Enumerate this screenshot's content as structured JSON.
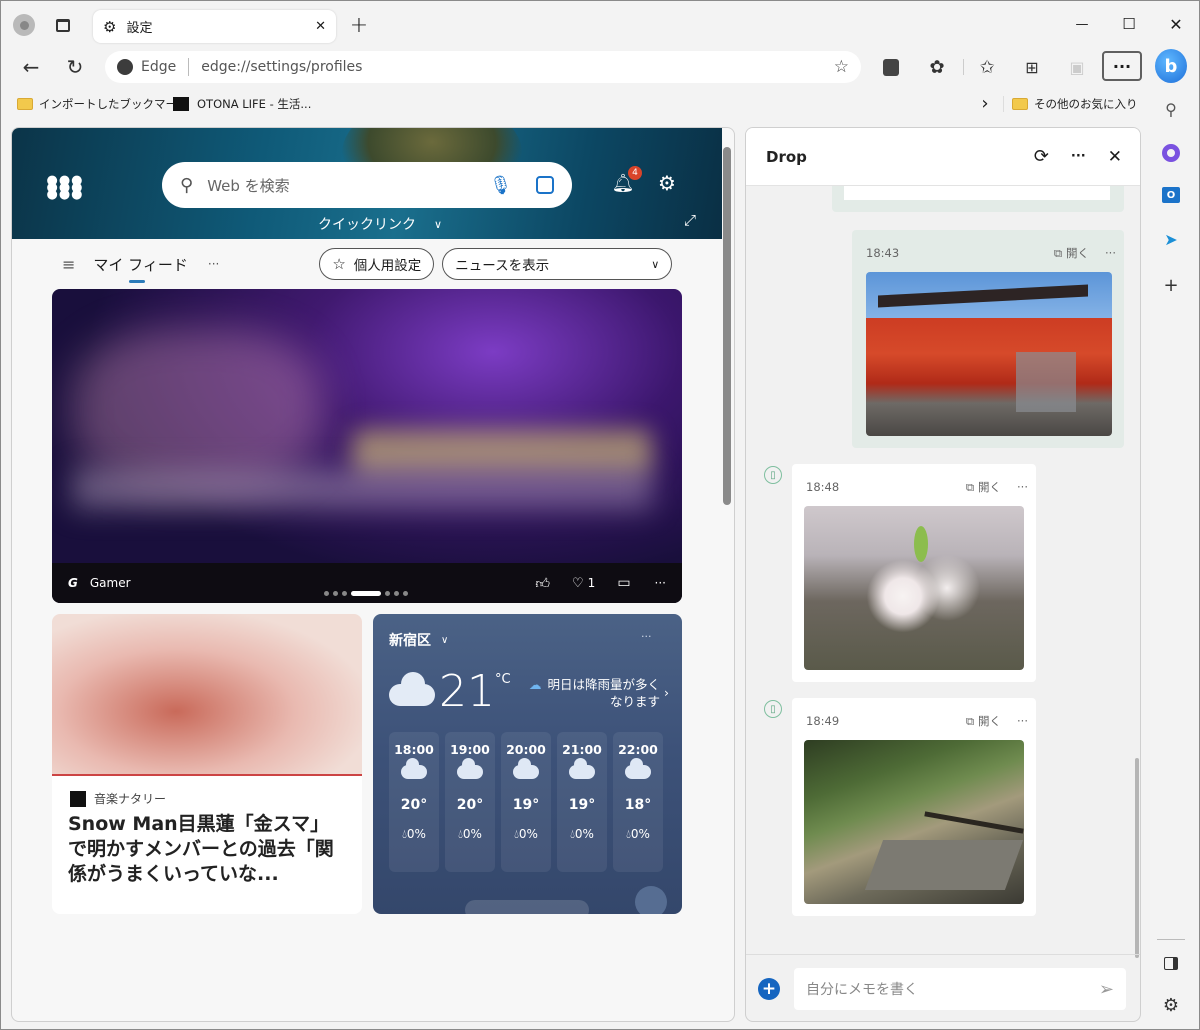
{
  "window": {
    "tab_title": "設定",
    "new_tab_glyph": "+",
    "controls": {
      "minimize": "—",
      "maximize": "☐",
      "close": "✕"
    }
  },
  "toolbar": {
    "back_glyph": "←",
    "refresh_glyph": "↻",
    "address_site": "Edge",
    "address_url": "edge://settings/profiles",
    "more_glyph": "···"
  },
  "bookmarks": {
    "items": [
      {
        "label": "インポートしたブックマー...",
        "icon": "folder-icon"
      },
      {
        "label": "OTONA LIFE - 生活...",
        "icon": "otona-favicon"
      }
    ],
    "overflow_glyph": "›",
    "other_label": "その他のお気に入り"
  },
  "newtab": {
    "search_placeholder": "Web を検索",
    "notification_count": "4",
    "quick_links_label": "クイックリンク",
    "feed_label": "マイ フィード",
    "feed_more": "···",
    "personalize_label": "個人用設定",
    "news_dropdown": "ニュースを表示",
    "hero": {
      "source": "Gamer",
      "dislike_count": "1",
      "more": "···",
      "carousel_total": 7,
      "carousel_active": 4
    },
    "news": {
      "source": "音楽ナタリー",
      "headline": "Snow Man目黒蓮「金スマ」で明かすメンバーとの過去「関係がうまくいっていな..."
    },
    "weather": {
      "location": "新宿区",
      "more": "···",
      "temp": "21",
      "unit": "°C",
      "alert": "明日は降雨量が多くなります",
      "hours": [
        {
          "time": "18:00",
          "temp": "20°",
          "rain": "0%",
          "icon": "partly-cloudy-sun"
        },
        {
          "time": "19:00",
          "temp": "20°",
          "rain": "0%",
          "icon": "partly-cloudy-moon"
        },
        {
          "time": "20:00",
          "temp": "19°",
          "rain": "0%",
          "icon": "cloudy-moon"
        },
        {
          "time": "21:00",
          "temp": "19°",
          "rain": "0%",
          "icon": "partly-cloudy-moon"
        },
        {
          "time": "22:00",
          "temp": "18°",
          "rain": "0%",
          "icon": "partly-cloudy-moon"
        }
      ]
    }
  },
  "drop": {
    "title": "Drop",
    "open_label": "開く",
    "more": "···",
    "messages": [
      {
        "time": "18:43",
        "photo": "Fushimi Inari shrine gate",
        "from": "this-device"
      },
      {
        "time": "18:48",
        "photo": "Cherry blossoms",
        "from": "phone"
      },
      {
        "time": "18:49",
        "photo": "Cafe terrace with plants",
        "from": "phone"
      }
    ],
    "input_placeholder": "自分にメモを書く"
  },
  "sidebar": {
    "items": [
      "bing-chat",
      "search",
      "copilot",
      "outlook",
      "send",
      "add"
    ]
  }
}
